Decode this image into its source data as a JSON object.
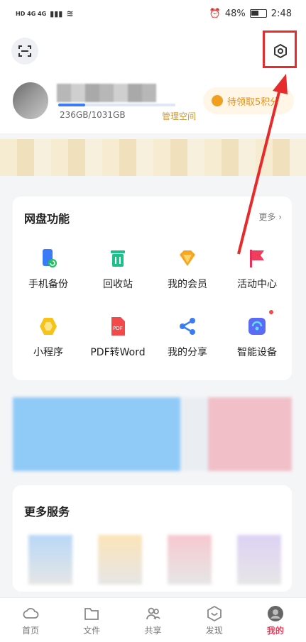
{
  "status_bar": {
    "network_left": "HD 4G 4G",
    "battery": "48%",
    "time": "2:48"
  },
  "header": {
    "scan_icon": "scan-icon",
    "settings_icon": "settings-icon"
  },
  "profile": {
    "storage_text": "236GB/1031GB",
    "storage_used_fraction": 0.229,
    "manage_space": "管理空间",
    "points_button": "待领取5积分"
  },
  "functions": {
    "title": "网盘功能",
    "more": "更多",
    "items": [
      {
        "label": "手机备份",
        "icon": "phone-backup-icon"
      },
      {
        "label": "回收站",
        "icon": "recycle-bin-icon"
      },
      {
        "label": "我的会员",
        "icon": "vip-icon"
      },
      {
        "label": "活动中心",
        "icon": "activity-flag-icon"
      },
      {
        "label": "小程序",
        "icon": "mini-program-icon"
      },
      {
        "label": "PDF转Word",
        "icon": "pdf-icon"
      },
      {
        "label": "我的分享",
        "icon": "share-icon"
      },
      {
        "label": "智能设备",
        "icon": "smart-device-icon"
      }
    ]
  },
  "more_services": {
    "title": "更多服务"
  },
  "tabbar": {
    "items": [
      {
        "label": "首页",
        "icon": "home-icon"
      },
      {
        "label": "文件",
        "icon": "folder-icon"
      },
      {
        "label": "共享",
        "icon": "people-icon"
      },
      {
        "label": "发现",
        "icon": "discover-icon"
      },
      {
        "label": "我的",
        "icon": "profile-icon"
      }
    ],
    "active_index": 4
  },
  "colors": {
    "accent_blue": "#3b7cf6",
    "highlight_red": "#e52b2b",
    "active_tab": "#f03d5e",
    "gold": "#e0901f"
  }
}
